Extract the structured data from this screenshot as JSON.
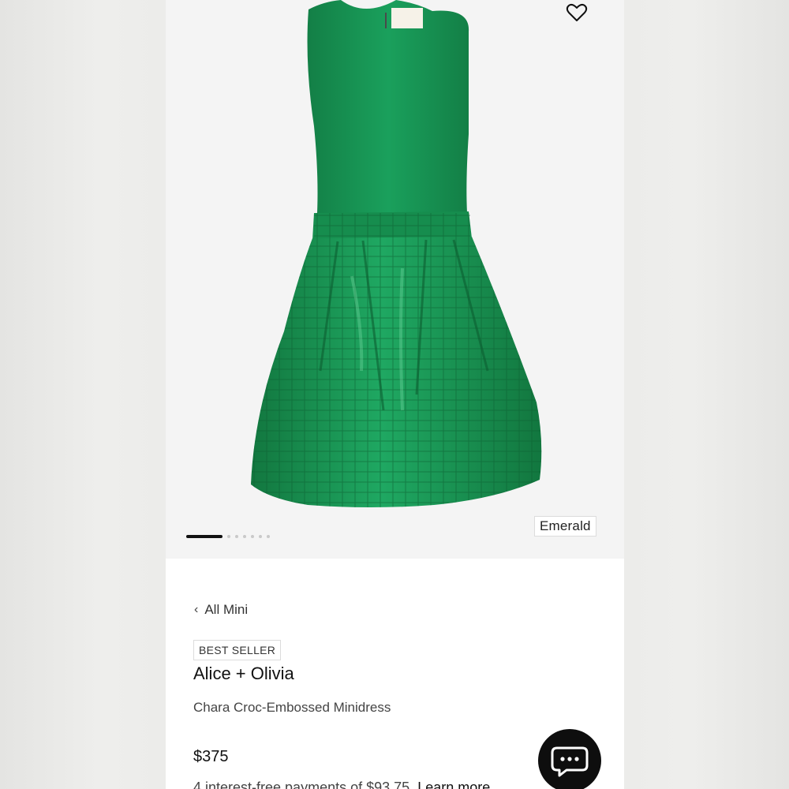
{
  "gallery": {
    "favorite_icon": "heart-outline-icon",
    "color_label": "Emerald",
    "dress_color": "#179a55",
    "image_count": 7,
    "active_index": 0
  },
  "breadcrumb": {
    "label": "All Mini",
    "icon": "chevron-left-icon"
  },
  "product": {
    "badge": "BEST SELLER",
    "brand": "Alice + Olivia",
    "name": "Chara Croc-Embossed Minidress",
    "price": "$375",
    "installments_text": "4 interest-free payments of $93.75.",
    "learn_more": "Learn more"
  },
  "chat": {
    "icon": "chat-bubble-icon"
  }
}
